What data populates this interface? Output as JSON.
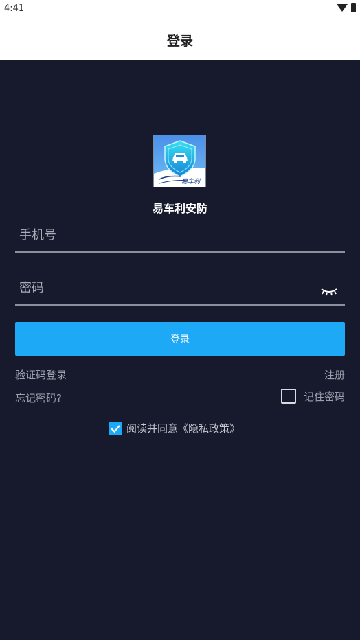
{
  "status_bar": {
    "time": "4:41"
  },
  "header": {
    "title": "登录"
  },
  "brand": {
    "app_name": "易车利安防",
    "logo_text": "易车利"
  },
  "form": {
    "phone_placeholder": "手机号",
    "password_placeholder": "密码",
    "login_button": "登录"
  },
  "links": {
    "code_login": "验证码登录",
    "register": "注册",
    "forgot_password": "忘记密码?",
    "remember_password": "记住密码",
    "remember_checked": false
  },
  "agreement": {
    "text": "阅读并同意《隐私政策》",
    "checked": true
  },
  "colors": {
    "background": "#161a2c",
    "accent": "#1ea9f7",
    "header": "#ffffff"
  }
}
